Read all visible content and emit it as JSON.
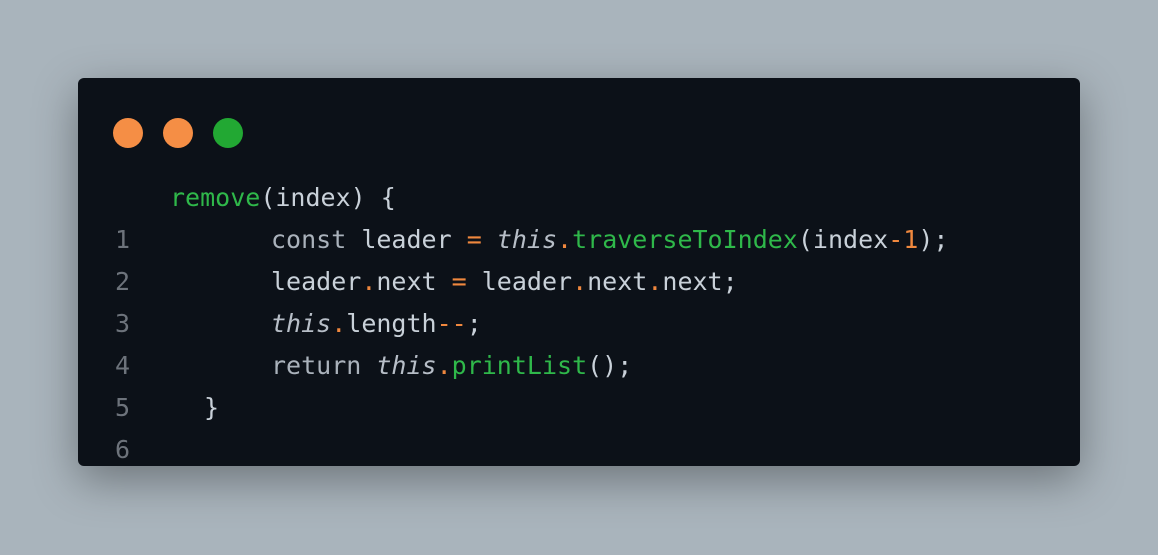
{
  "window": {
    "controls": [
      {
        "name": "close",
        "color": "#f58e45"
      },
      {
        "name": "minimize",
        "color": "#f58e45"
      },
      {
        "name": "maximize",
        "color": "#22a833"
      }
    ]
  },
  "code": {
    "line_numbers": [
      "1",
      "2",
      "3",
      "4",
      "5",
      "6"
    ],
    "lines": [
      [
        {
          "t": "remove",
          "k": "fn"
        },
        {
          "t": "(index) {",
          "k": "plain"
        }
      ],
      [
        {
          "t": "const",
          "k": "kw"
        },
        {
          "t": " leader ",
          "k": "plain"
        },
        {
          "t": "=",
          "k": "op"
        },
        {
          "t": " ",
          "k": "plain"
        },
        {
          "t": "this",
          "k": "this"
        },
        {
          "t": ".",
          "k": "op"
        },
        {
          "t": "traverseToIndex",
          "k": "fn"
        },
        {
          "t": "(index",
          "k": "plain"
        },
        {
          "t": "-",
          "k": "op"
        },
        {
          "t": "1",
          "k": "num"
        },
        {
          "t": ");",
          "k": "plain"
        }
      ],
      [
        {
          "t": "leader",
          "k": "plain"
        },
        {
          "t": ".",
          "k": "op"
        },
        {
          "t": "next ",
          "k": "plain"
        },
        {
          "t": "=",
          "k": "op"
        },
        {
          "t": " leader",
          "k": "plain"
        },
        {
          "t": ".",
          "k": "op"
        },
        {
          "t": "next",
          "k": "plain"
        },
        {
          "t": ".",
          "k": "op"
        },
        {
          "t": "next;",
          "k": "plain"
        }
      ],
      [
        {
          "t": "this",
          "k": "this"
        },
        {
          "t": ".",
          "k": "op"
        },
        {
          "t": "length",
          "k": "plain"
        },
        {
          "t": "--",
          "k": "op"
        },
        {
          "t": ";",
          "k": "plain"
        }
      ],
      [
        {
          "t": "return",
          "k": "kw"
        },
        {
          "t": " ",
          "k": "plain"
        },
        {
          "t": "this",
          "k": "this"
        },
        {
          "t": ".",
          "k": "op"
        },
        {
          "t": "printList",
          "k": "fn"
        },
        {
          "t": "();",
          "k": "plain"
        }
      ],
      [
        {
          "t": "}",
          "k": "plain"
        }
      ]
    ]
  }
}
